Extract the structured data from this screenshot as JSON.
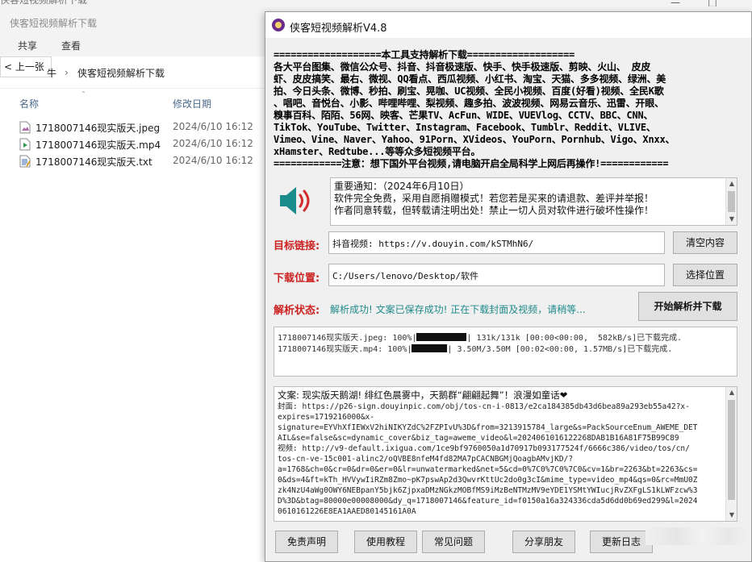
{
  "explorer": {
    "top_cut_text": "侠客短视频解析下载",
    "title": "侠客短视频解析下载",
    "ribbon_tabs": [
      "共享",
      "查看"
    ],
    "back_label": "上一张",
    "address_partial": "牛",
    "address_path": "侠客短视频解析下载",
    "columns": {
      "name": "名称",
      "modified": "修改日期"
    },
    "files": [
      {
        "name": "1718007146现实版天.jpeg",
        "date": "2024/6/10 16:12",
        "icon": "image-file-icon"
      },
      {
        "name": "1718007146现实版天.mp4",
        "date": "2024/6/10 16:12",
        "icon": "video-file-icon"
      },
      {
        "name": "1718007146现实版天.txt",
        "date": "2024/6/10 16:12",
        "icon": "text-file-icon"
      }
    ]
  },
  "app": {
    "title": "侠客短视频解析V4.8",
    "platforms_text": "===================本工具支持解析下载===================\n各大平台图集、微信公众号、抖音、抖音极速版、快手、快手极速版、剪映、火山、 皮皮\n虾、皮皮搞笑、最右、微视、QQ看点、西瓜视频、小红书、淘宝、天猫、多多视频、绿洲、美\n拍、今日头条、微博、秒拍、刷宝、晃咖、UC视频、全民小视频、百度(好看)视频、全民K歌\n、唱吧、音悦台、小影、哔哩哔哩、梨视频、趣多拍、波波视频、网易云音乐、迅雷、开眼、\n糗事百科、陌陌、56网、映客、芒果TV、AcFun、WIDE、VUEVlog、CCTV、BBC、CNN、\nTikTok、YouTube、Twitter、Instagram、Facebook、Tumblr、Reddit、VLIVE、\nVimeo、Vine、Naver、Yahoo、91Porn、XVideos、YouPorn、Pornhub、Vigo、Xnxx、\nxHamster、Redtube...等等众多短视频平台。\n============注意：想下国外平台视频,请电脑开启全局科学上网后再操作!============",
    "notice": {
      "lines": [
        "重要通知：（2024年6月10日）",
        "软件完全免费，采用自愿捐赠模式！若您若是买来的请退款、差评并举报！",
        "作者同意转载，但转载请注明出处！禁止一切人员对软件进行破坏性操作！"
      ]
    },
    "target": {
      "label": "目标链接:",
      "value": "抖音视频: https://v.douyin.com/kSTMhN6/",
      "button": "清空内容"
    },
    "download": {
      "label": "下载位置:",
      "value": "C:/Users/lenovo/Desktop/软件",
      "button": "选择位置"
    },
    "status": {
      "label": "解析状态:",
      "value": "解析成功! 文案已保存成功! 正在下载封面及视频，请稍等...",
      "button": "开始解析并下载"
    },
    "progress": [
      {
        "prefix": "1718007146现实版天.jpeg: 100%|",
        "percent": 100,
        "suffix": "| 131k/131k [00:00<00:00,  582kB/s]已下载完成."
      },
      {
        "prefix": "1718007146现实版天.mp4: 100%|",
        "percent": 100,
        "suffix": "| 3.50M/3.50M [00:02<00:00, 1.57MB/s]已下载完成."
      }
    ],
    "log": {
      "first": "文案: 现实版天鹅湖! 绯红色晨雾中，天鹅群“翩翩起舞”！浪漫如童话❤",
      "rest": "封面: https://p26-sign.douyinpic.com/obj/tos-cn-i-0813/e2ca184385db43d6bea89a293eb55a42?x-\nexpires=1719216000&x-\nsignature=EYVhXfIEWxV2hiNIKYZdC%2FZPIvU%3D&from=3213915784_large&s=PackSourceEnum_AWEME_DET\nAIL&se=false&sc=dynamic_cover&biz_tag=aweme_video&l=2024061016122268DAB1B16A81F75B99C89\n视频: http://v9-default.ixigua.com/1ce9bf9760050a1d70917b093177524f/6666c386/video/tos/cn/\ntos-cn-ve-15c001-alinc2/oQVBE8nfeM4fd82MA7pCACNBGMjQoagbAMvjKD/?\na=1768&ch=0&cr=0&dr=0&er=0&lr=unwatermarked&net=5&cd=0%7C0%7C0%7C0&cv=1&br=2263&bt=2263&cs=\n0&ds=4&ft=kTh_HVVywIiRZm8Zmo~pK7pswAp2d3QwvrKttUc2do0g3cI&mime_type=video_mp4&qs=0&rc=MmU0Z\nzk4NzU4aWg0OWY6NEBpanY5bjk6ZjpxaDMzNGkzMOBfMS9iMzBeNTMzMV9eYDE1YSMtYWIucjRvZXFgLS1kLWFzcw%3\nD%3D&btag=80000e00008000&dy_q=1718007146&feature_id=f0150a16a324336cda5d6dd0b69ed299&l=2024\n0610161226E8EA1AAED80145161A0A"
    },
    "footer_buttons": [
      "免责声明",
      "使用教程",
      "常见问题",
      "分享朋友",
      "更新日志"
    ],
    "colors": {
      "label_red": "#cc2222",
      "status_teal": "#1f8a8a",
      "speaker_teal": "#1b8c8c",
      "speaker_red": "#d22b2b"
    }
  }
}
